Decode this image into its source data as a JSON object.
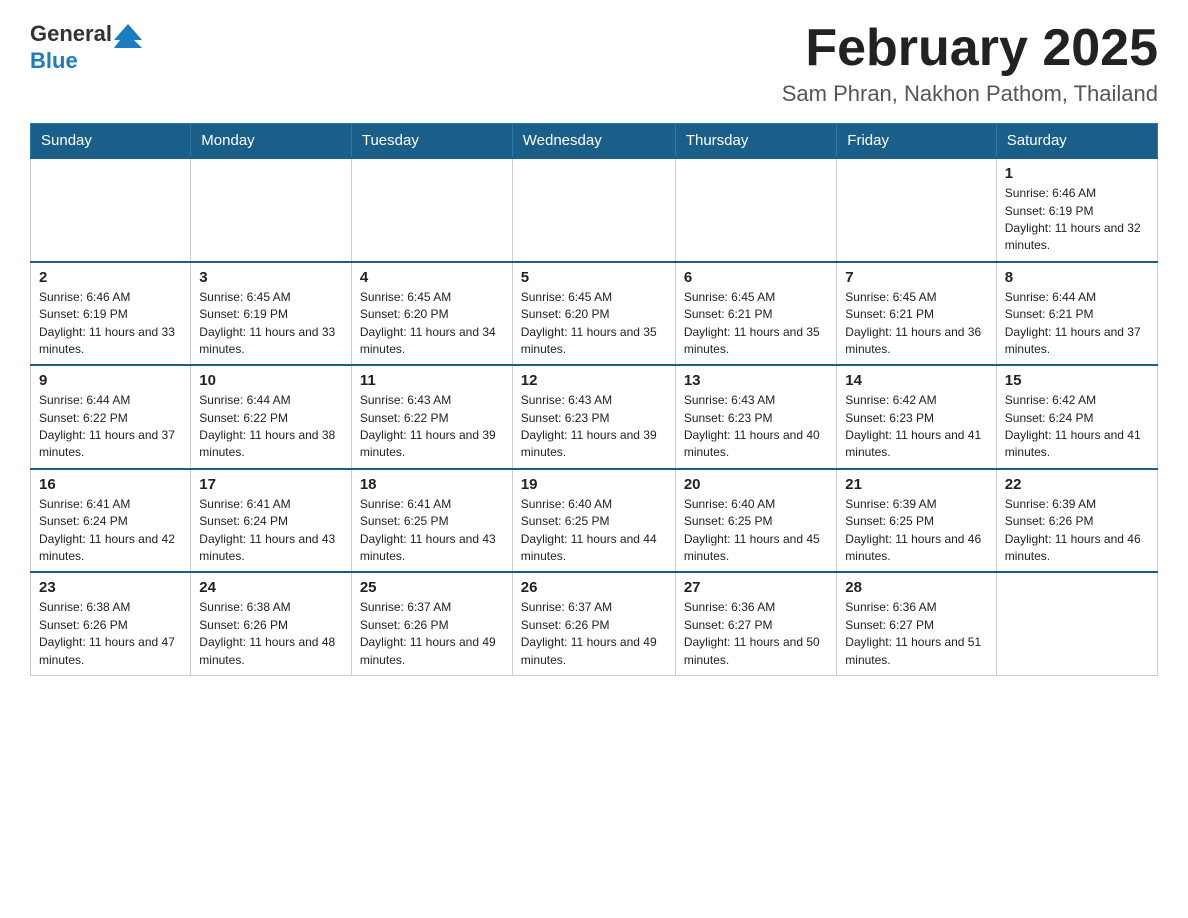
{
  "header": {
    "logo_general": "General",
    "logo_blue": "Blue",
    "month_title": "February 2025",
    "location": "Sam Phran, Nakhon Pathom, Thailand"
  },
  "weekdays": [
    "Sunday",
    "Monday",
    "Tuesday",
    "Wednesday",
    "Thursday",
    "Friday",
    "Saturday"
  ],
  "weeks": [
    [
      {
        "day": "",
        "info": ""
      },
      {
        "day": "",
        "info": ""
      },
      {
        "day": "",
        "info": ""
      },
      {
        "day": "",
        "info": ""
      },
      {
        "day": "",
        "info": ""
      },
      {
        "day": "",
        "info": ""
      },
      {
        "day": "1",
        "info": "Sunrise: 6:46 AM\nSunset: 6:19 PM\nDaylight: 11 hours and 32 minutes."
      }
    ],
    [
      {
        "day": "2",
        "info": "Sunrise: 6:46 AM\nSunset: 6:19 PM\nDaylight: 11 hours and 33 minutes."
      },
      {
        "day": "3",
        "info": "Sunrise: 6:45 AM\nSunset: 6:19 PM\nDaylight: 11 hours and 33 minutes."
      },
      {
        "day": "4",
        "info": "Sunrise: 6:45 AM\nSunset: 6:20 PM\nDaylight: 11 hours and 34 minutes."
      },
      {
        "day": "5",
        "info": "Sunrise: 6:45 AM\nSunset: 6:20 PM\nDaylight: 11 hours and 35 minutes."
      },
      {
        "day": "6",
        "info": "Sunrise: 6:45 AM\nSunset: 6:21 PM\nDaylight: 11 hours and 35 minutes."
      },
      {
        "day": "7",
        "info": "Sunrise: 6:45 AM\nSunset: 6:21 PM\nDaylight: 11 hours and 36 minutes."
      },
      {
        "day": "8",
        "info": "Sunrise: 6:44 AM\nSunset: 6:21 PM\nDaylight: 11 hours and 37 minutes."
      }
    ],
    [
      {
        "day": "9",
        "info": "Sunrise: 6:44 AM\nSunset: 6:22 PM\nDaylight: 11 hours and 37 minutes."
      },
      {
        "day": "10",
        "info": "Sunrise: 6:44 AM\nSunset: 6:22 PM\nDaylight: 11 hours and 38 minutes."
      },
      {
        "day": "11",
        "info": "Sunrise: 6:43 AM\nSunset: 6:22 PM\nDaylight: 11 hours and 39 minutes."
      },
      {
        "day": "12",
        "info": "Sunrise: 6:43 AM\nSunset: 6:23 PM\nDaylight: 11 hours and 39 minutes."
      },
      {
        "day": "13",
        "info": "Sunrise: 6:43 AM\nSunset: 6:23 PM\nDaylight: 11 hours and 40 minutes."
      },
      {
        "day": "14",
        "info": "Sunrise: 6:42 AM\nSunset: 6:23 PM\nDaylight: 11 hours and 41 minutes."
      },
      {
        "day": "15",
        "info": "Sunrise: 6:42 AM\nSunset: 6:24 PM\nDaylight: 11 hours and 41 minutes."
      }
    ],
    [
      {
        "day": "16",
        "info": "Sunrise: 6:41 AM\nSunset: 6:24 PM\nDaylight: 11 hours and 42 minutes."
      },
      {
        "day": "17",
        "info": "Sunrise: 6:41 AM\nSunset: 6:24 PM\nDaylight: 11 hours and 43 minutes."
      },
      {
        "day": "18",
        "info": "Sunrise: 6:41 AM\nSunset: 6:25 PM\nDaylight: 11 hours and 43 minutes."
      },
      {
        "day": "19",
        "info": "Sunrise: 6:40 AM\nSunset: 6:25 PM\nDaylight: 11 hours and 44 minutes."
      },
      {
        "day": "20",
        "info": "Sunrise: 6:40 AM\nSunset: 6:25 PM\nDaylight: 11 hours and 45 minutes."
      },
      {
        "day": "21",
        "info": "Sunrise: 6:39 AM\nSunset: 6:25 PM\nDaylight: 11 hours and 46 minutes."
      },
      {
        "day": "22",
        "info": "Sunrise: 6:39 AM\nSunset: 6:26 PM\nDaylight: 11 hours and 46 minutes."
      }
    ],
    [
      {
        "day": "23",
        "info": "Sunrise: 6:38 AM\nSunset: 6:26 PM\nDaylight: 11 hours and 47 minutes."
      },
      {
        "day": "24",
        "info": "Sunrise: 6:38 AM\nSunset: 6:26 PM\nDaylight: 11 hours and 48 minutes."
      },
      {
        "day": "25",
        "info": "Sunrise: 6:37 AM\nSunset: 6:26 PM\nDaylight: 11 hours and 49 minutes."
      },
      {
        "day": "26",
        "info": "Sunrise: 6:37 AM\nSunset: 6:26 PM\nDaylight: 11 hours and 49 minutes."
      },
      {
        "day": "27",
        "info": "Sunrise: 6:36 AM\nSunset: 6:27 PM\nDaylight: 11 hours and 50 minutes."
      },
      {
        "day": "28",
        "info": "Sunrise: 6:36 AM\nSunset: 6:27 PM\nDaylight: 11 hours and 51 minutes."
      },
      {
        "day": "",
        "info": ""
      }
    ]
  ]
}
